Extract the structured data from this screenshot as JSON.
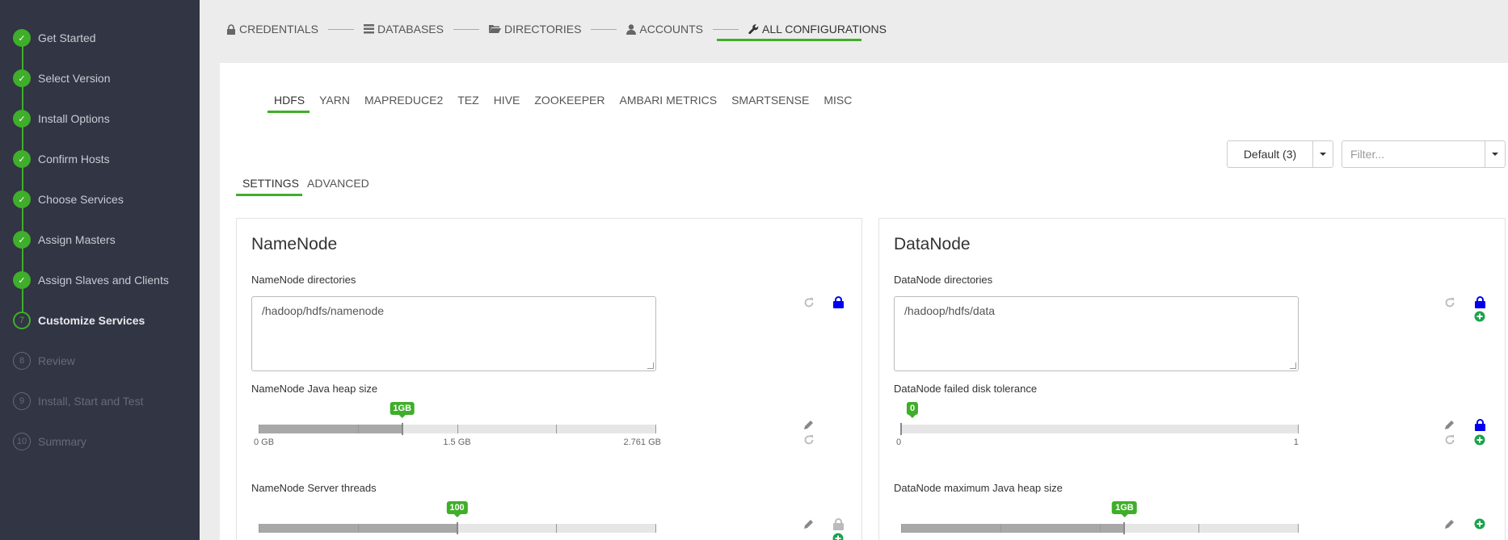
{
  "sidebar": {
    "steps": [
      {
        "num": "✓",
        "label": "Get Started",
        "state": "done"
      },
      {
        "num": "✓",
        "label": "Select Version",
        "state": "done"
      },
      {
        "num": "✓",
        "label": "Install Options",
        "state": "done"
      },
      {
        "num": "✓",
        "label": "Confirm Hosts",
        "state": "done"
      },
      {
        "num": "✓",
        "label": "Choose Services",
        "state": "done"
      },
      {
        "num": "✓",
        "label": "Assign Masters",
        "state": "done"
      },
      {
        "num": "✓",
        "label": "Assign Slaves and Clients",
        "state": "done"
      },
      {
        "num": "7",
        "label": "Customize Services",
        "state": "current"
      },
      {
        "num": "8",
        "label": "Review",
        "state": "todo"
      },
      {
        "num": "9",
        "label": "Install, Start and Test",
        "state": "todo"
      },
      {
        "num": "10",
        "label": "Summary",
        "state": "todo"
      }
    ]
  },
  "topnav": {
    "credentials": "CREDENTIALS",
    "databases": "DATABASES",
    "directories": "DIRECTORIES",
    "accounts": "ACCOUNTS",
    "all_configurations": "ALL CONFIGURATIONS"
  },
  "service_tabs": [
    "HDFS",
    "YARN",
    "MAPREDUCE2",
    "TEZ",
    "HIVE",
    "ZOOKEEPER",
    "AMBARI METRICS",
    "SMARTSENSE",
    "MISC"
  ],
  "config_group": {
    "label": "Default (3)"
  },
  "filter": {
    "placeholder": "Filter..."
  },
  "sub_tabs": {
    "settings": "SETTINGS",
    "advanced": "ADVANCED"
  },
  "namenode": {
    "title": "NameNode",
    "dirs_label": "NameNode directories",
    "dirs_value": "/hadoop/hdfs/namenode",
    "heap_label": "NameNode Java heap size",
    "heap_value": "1GB",
    "heap_fraction": 0.362,
    "heap_ticks": [
      "0 GB",
      "1.5 GB",
      "2.761 GB"
    ],
    "threads_label": "NameNode Server threads",
    "threads_value": "100",
    "threads_fraction": 0.5
  },
  "datanode": {
    "title": "DataNode",
    "dirs_label": "DataNode directories",
    "dirs_value": "/hadoop/hdfs/data",
    "tolerance_label": "DataNode failed disk tolerance",
    "tolerance_value": "0",
    "tolerance_fraction": 0,
    "tolerance_ticks": [
      "0",
      "1"
    ],
    "heap_label": "DataNode maximum Java heap size",
    "heap_value": "1GB",
    "heap_fraction": 0.563
  },
  "colors": {
    "accent": "#3fae2a",
    "sidebar_bg": "#323544",
    "lock_blue": "#0000ee"
  },
  "icons": [
    "check-icon",
    "lock-icon",
    "database-icon",
    "folder-icon",
    "user-icon",
    "wrench-icon",
    "undo-icon",
    "pencil-icon",
    "plus-circle-icon",
    "caret-down-icon"
  ]
}
